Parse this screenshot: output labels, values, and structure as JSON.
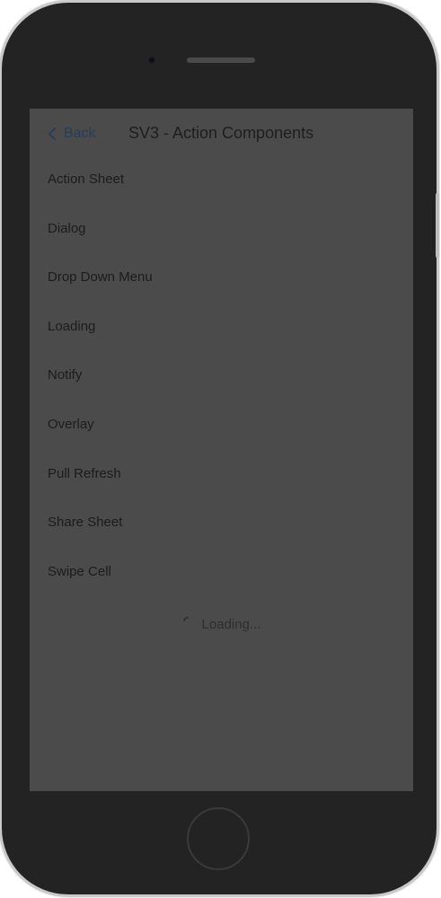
{
  "nav": {
    "back_label": "Back",
    "title": "SV3 - Action Components"
  },
  "menu": {
    "items": [
      {
        "label": "Action Sheet"
      },
      {
        "label": "Dialog"
      },
      {
        "label": "Drop Down Menu"
      },
      {
        "label": "Loading"
      },
      {
        "label": "Notify"
      },
      {
        "label": "Overlay"
      },
      {
        "label": "Pull Refresh"
      },
      {
        "label": "Share Sheet"
      },
      {
        "label": "Swipe Cell"
      }
    ]
  },
  "status": {
    "loading_text": "Loading..."
  },
  "icons": {
    "back": "chevron-left-icon",
    "spinner": "spinner-icon"
  },
  "colors": {
    "screen_overlay": "#4b4b4b",
    "back_link": "#2a3d57",
    "device_body": "#232323"
  }
}
